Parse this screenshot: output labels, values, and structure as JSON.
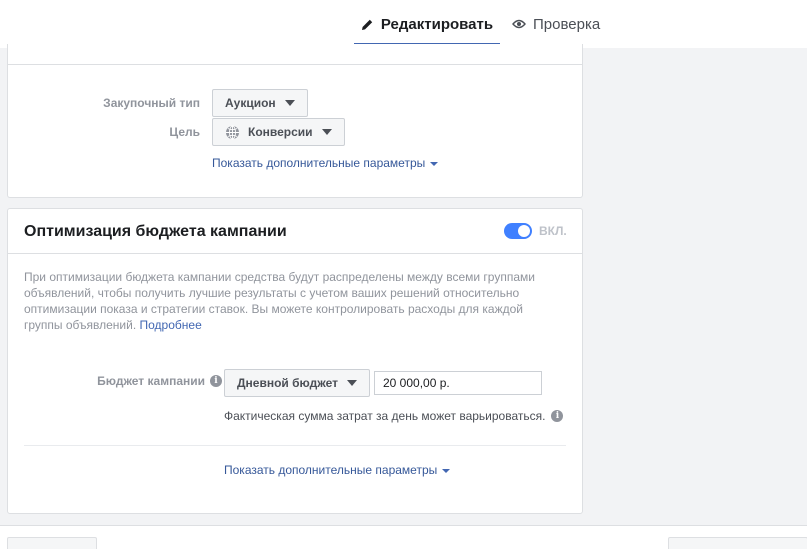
{
  "tabs": {
    "edit_label": "Редактировать",
    "review_label": "Проверка",
    "edit_icon": "pencil-icon",
    "review_icon": "eye-icon"
  },
  "bidding": {
    "purchase_type_label": "Закупочный тип",
    "purchase_type_value": "Аукцион",
    "goal_label": "Цель",
    "goal_value": "Конверсии",
    "goal_icon": "globe-icon",
    "more_options": "Показать дополнительные параметры"
  },
  "cbo": {
    "title": "Оптимизация бюджета кампании",
    "toggle_label": "ВКЛ.",
    "toggle_on": true,
    "description": "При оптимизации бюджета кампании средства будут распределены между всеми группами объявлений, чтобы получить лучшие результаты с учетом ваших решений относительно оптимизации показа и стратегии ставок. Вы можете контролировать расходы для каждой группы объявлений.",
    "learn_more": "Подробнее",
    "budget_label": "Бюджет кампании",
    "budget_type": "Дневной бюджет",
    "budget_value": "20 000,00 р.",
    "budget_note": "Фактическая сумма затрат за день может варьироваться.",
    "more_options": "Показать дополнительные параметры"
  },
  "colors": {
    "accent": "#4267b2",
    "toggle_on": "#4080ff",
    "link": "#365899"
  }
}
